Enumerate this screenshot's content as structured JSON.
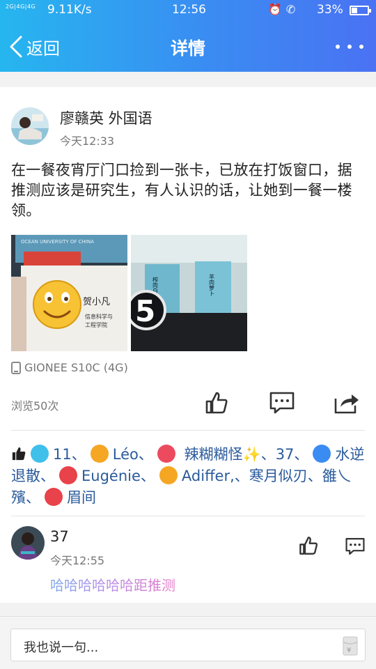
{
  "status_bar": {
    "network": "2G|4G|4G",
    "speed": "9.11K/s",
    "time": "12:56",
    "battery": "33%"
  },
  "nav": {
    "back_label": "返回",
    "title": "详情"
  },
  "post": {
    "author": "廖赣英 外国语",
    "time": "今天12:33",
    "content": "在一餐夜宵厅门口捡到一张卡，已放在打饭窗口，据推测应该是研究生，有人认识的话，让她到一餐一楼领。",
    "images": [
      {
        "card_header": "OCEAN UNIVERSITY OF CHINA",
        "card_name": "贺小凡",
        "card_dept_1": "信息科学与",
        "card_dept_2": "工程学院"
      },
      {
        "number": "5",
        "sign_1": "榨肉白菜",
        "sign_2": "羊肉萝卜"
      }
    ],
    "device": "GIONEE S10C (4G)",
    "views": "浏览50次"
  },
  "likes": {
    "names": [
      "11",
      "Léo",
      "辣糊糊怪✨",
      "37",
      "水逆退散",
      "Eugénie",
      "Adiffer,",
      "寒月似刃",
      "雒乀殯",
      "眉间"
    ],
    "colors": [
      "#3fc0ea",
      "#f5a623",
      "#ec4b5f",
      "#3a8cf2",
      "#e8424a",
      "#f5a623",
      "#e8424a"
    ]
  },
  "comment": {
    "author": "37",
    "time": "今天12:55",
    "text": "哈哈哈哈哈哈距推测"
  },
  "input": {
    "placeholder": "我也说一句..."
  },
  "colors": {
    "accent": "#3a8cf2",
    "link": "#2a5b9c"
  }
}
